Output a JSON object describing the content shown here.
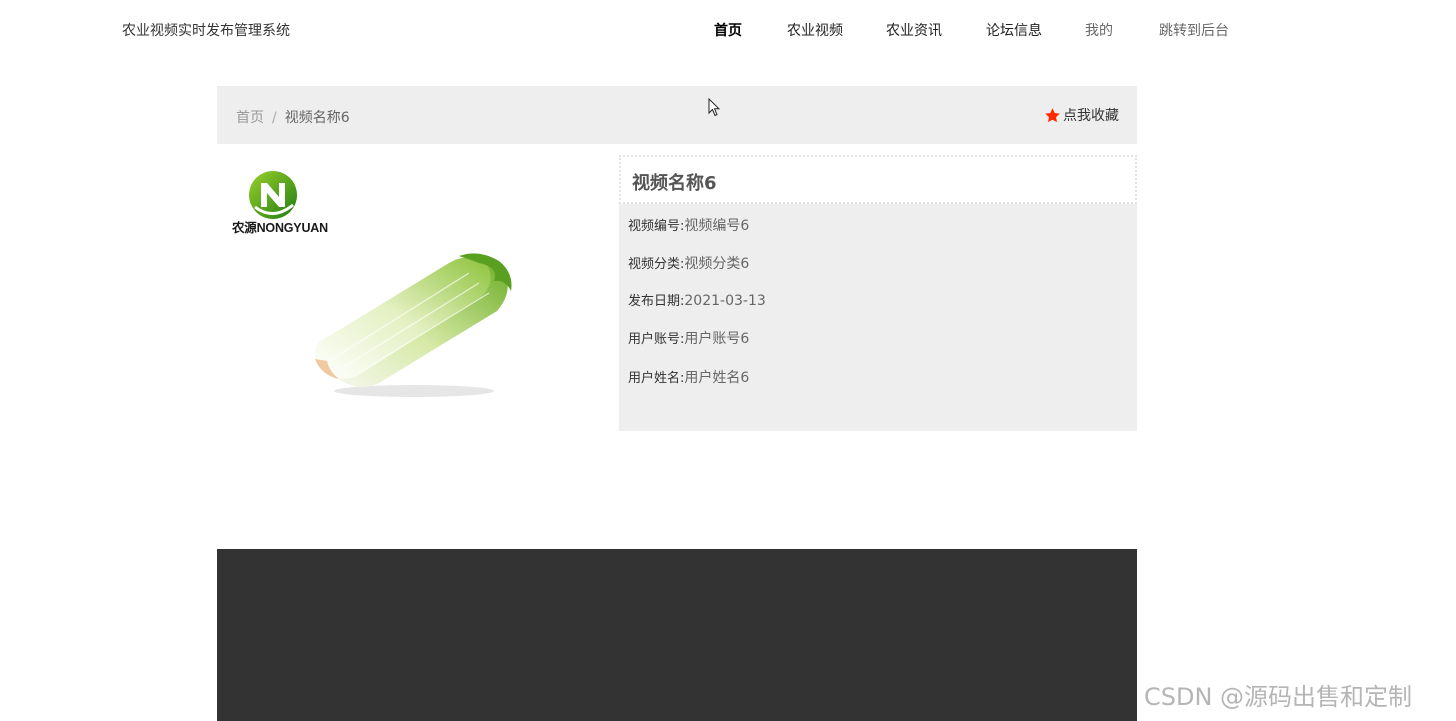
{
  "header": {
    "site_title": "农业视频实时发布管理系统",
    "nav": [
      {
        "label": "首页",
        "active": true
      },
      {
        "label": "农业视频",
        "active": false
      },
      {
        "label": "农业资讯",
        "active": false
      },
      {
        "label": "论坛信息",
        "active": false
      },
      {
        "label": "我的",
        "active": false
      },
      {
        "label": "跳转到后台",
        "active": false
      }
    ]
  },
  "breadcrumb": {
    "home": "首页",
    "separator": "/",
    "current": "视频名称6"
  },
  "favorite": {
    "label": "点我收藏",
    "icon": "star-icon",
    "color": "#ff2a00"
  },
  "media": {
    "logo_text": "农源NONGYUAN",
    "image": "cabbage-image"
  },
  "detail": {
    "title": "视频名称6",
    "fields": [
      {
        "label": "视频编号:",
        "value": "视频编号6"
      },
      {
        "label": "视频分类:",
        "value": "视频分类6"
      },
      {
        "label": "发布日期:",
        "value": "2021-03-13"
      },
      {
        "label": "用户账号:",
        "value": "用户账号6"
      },
      {
        "label": "用户姓名:",
        "value": "用户姓名6"
      }
    ]
  },
  "watermark": "CSDN @源码出售和定制",
  "colors": {
    "panel_bg": "#eeeeee",
    "footer_bg": "#333333",
    "logo_green": "#3a9a1a"
  }
}
